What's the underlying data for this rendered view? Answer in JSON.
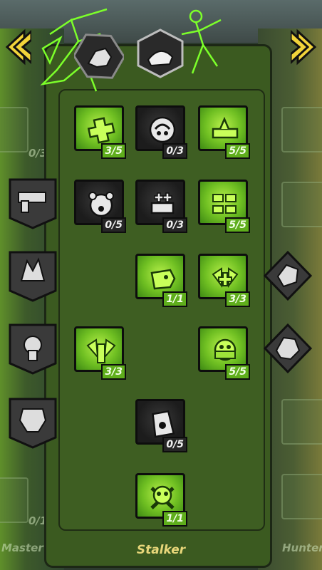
{
  "tree_title": "Stalker",
  "left_tree_label": "Master",
  "right_tree_label": "Hunter",
  "ghost_counts": {
    "left_top": "0/3",
    "left_bottom": "0/1"
  },
  "colors": {
    "active_green": "#6fbf22",
    "panel_green": "#3b5a20",
    "inactive": "#1c1c1c",
    "label_gold": "#e8d77a"
  },
  "skills": [
    {
      "icon": "crosshair-plus-icon",
      "count": "3/5",
      "state": "on"
    },
    {
      "icon": "claw-slash-icon",
      "count": "0/3",
      "state": "off"
    },
    {
      "icon": "dragon-gun-icon",
      "count": "5/5",
      "state": "on"
    },
    {
      "icon": "bear-face-icon",
      "count": "0/5",
      "state": "off"
    },
    {
      "icon": "health-stack-icon",
      "count": "0/3",
      "state": "off"
    },
    {
      "icon": "ammo-stack-icon",
      "count": "5/5",
      "state": "on"
    },
    {
      "icon": "robot-dog-icon",
      "count": "1/1",
      "state": "on"
    },
    {
      "icon": "winged-health-icon",
      "count": "3/3",
      "state": "on"
    },
    {
      "icon": "winged-ammo-icon",
      "count": "3/3",
      "state": "on"
    },
    {
      "icon": "bandana-skull-icon",
      "count": "5/5",
      "state": "on"
    },
    {
      "icon": "pet-food-bag-icon",
      "count": "0/5",
      "state": "off"
    },
    {
      "icon": "skull-crossbones-icon",
      "count": "1/1",
      "state": "on"
    }
  ]
}
